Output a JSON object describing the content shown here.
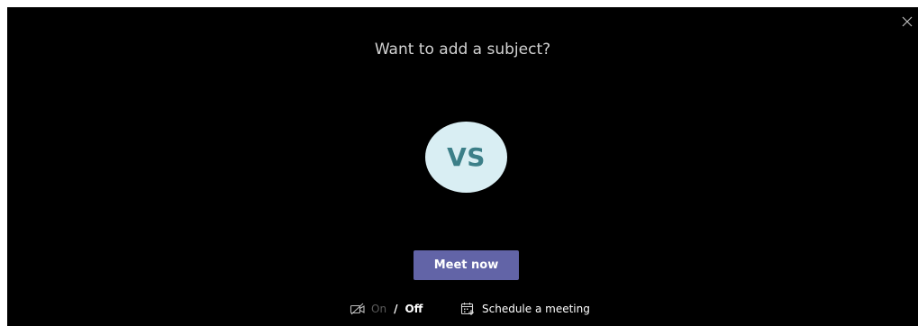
{
  "dialog": {
    "subject_prompt": "Want to add a subject?",
    "avatar_initials": "VS",
    "meet_now_label": "Meet now"
  },
  "video_toggle": {
    "on_label": "On",
    "separator": "/",
    "off_label": "Off"
  },
  "schedule": {
    "label": "Schedule a meeting"
  },
  "icons": {
    "close": "close-icon",
    "video_off": "video-off-icon",
    "calendar": "calendar-add-icon"
  },
  "colors": {
    "background": "#000000",
    "accent": "#6264a7",
    "avatar_bg": "#d9eef3",
    "avatar_text": "#3c7f88"
  }
}
